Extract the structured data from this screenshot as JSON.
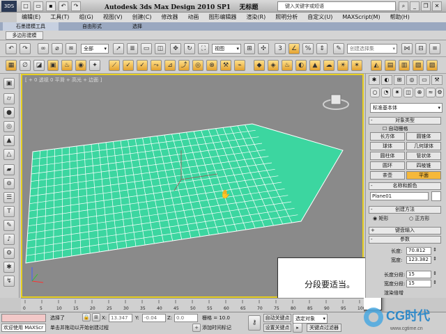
{
  "app": {
    "title": "Autodesk 3ds Max Design 2010 SP1",
    "doc": "无标题",
    "search_placeholder": "键入关键字或短语",
    "logo": "3DS"
  },
  "menu": [
    "编辑(E)",
    "工具(T)",
    "组(G)",
    "视图(V)",
    "创建(C)",
    "修改器",
    "动画",
    "图形编辑器",
    "渲染(R)",
    "照明分析",
    "自定义(U)",
    "MAXScript(M)",
    "帮助(H)"
  ],
  "ribbon": {
    "tabs": [
      "石墨建模工具",
      "自由形式",
      "选择"
    ],
    "subtab": "多边形建模"
  },
  "toolbar": {
    "filter": "全部",
    "refcoord": "视图",
    "named_sel": "创建选择集"
  },
  "viewport": {
    "label": "[ + 0 透视 0 平滑 + 高光 + 边面 ]",
    "overlay": "分段要适当。"
  },
  "panel": {
    "dropdown": "标准基本体",
    "rollouts": {
      "object_type": "对象类型",
      "autogrid": "自动栅格",
      "name_color": "名称和颜色",
      "creation": "创建方法",
      "keyboard": "键盘输入",
      "params": "参数"
    },
    "primitives": [
      "长方体",
      "圆锥体",
      "球体",
      "几何球体",
      "圆柱体",
      "管状体",
      "圆环",
      "四棱锥",
      "茶壶",
      "平面"
    ],
    "object_name": "Plane01",
    "creation_methods": [
      "矩形",
      "正方形"
    ],
    "length_label": "长度:",
    "length": "70.812",
    "width_label": "宽度:",
    "width": "123.382",
    "lsegs_label": "长度分段:",
    "lsegs": "15",
    "wsegs_label": "宽度分段:",
    "wsegs": "15",
    "render_mult": "渲染倍增",
    "scale_label": "缩放:"
  },
  "timeline": {
    "ticks": [
      "0",
      "5",
      "10",
      "15",
      "20",
      "25",
      "30",
      "35",
      "40",
      "45",
      "50",
      "55",
      "60",
      "65",
      "70",
      "75",
      "80",
      "85",
      "90",
      "95",
      "100"
    ]
  },
  "status": {
    "welcome": "欢迎使用 MAXScr",
    "selected": "选择了",
    "prompt": "单击并拖动以开始创建过程",
    "x_label": "X:",
    "x": "13.347",
    "y_label": "Y:",
    "y": "-0.04",
    "z_label": "Z:",
    "z": "0.0",
    "grid": "栅格 = 10.0",
    "add_time_tag": "添加时间标记",
    "autokey": "自动关键点",
    "setkey": "设置关键点",
    "selected_obj": "选定对象",
    "key_filter": "关键点过滤器"
  },
  "watermark": {
    "brand": "CG时代",
    "url": "www.cgtime.cn"
  }
}
